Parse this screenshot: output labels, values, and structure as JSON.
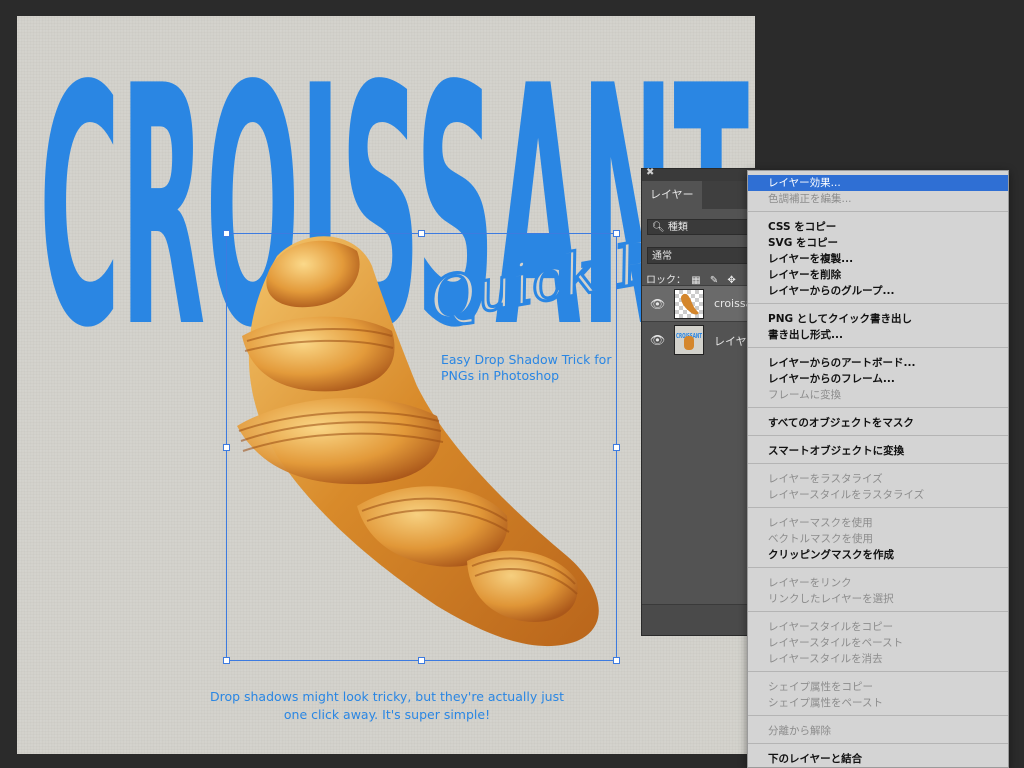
{
  "canvas": {
    "title_word": "CROISSANT",
    "script_subtitle": "Quick Pro Ti",
    "caption_top": "Easy Drop Shadow Trick for PNGs in Photoshop",
    "caption_bottom": "Drop shadows might look tricky, but they're actually just one click away. It's super simple!",
    "accent_color": "#2a86e3"
  },
  "layers_panel": {
    "tab_label": "レイヤー",
    "filter_label": "種類",
    "blend_mode": "通常",
    "lock_label": "ロック：",
    "layers": [
      {
        "name": "croissa",
        "icon": "croissant-thumbnail"
      },
      {
        "name": "レイヤー",
        "icon": "poster-thumbnail",
        "thumb_text": "CROISSANT"
      }
    ]
  },
  "context_menu": {
    "items": [
      {
        "label": "レイヤー効果...",
        "state": "highlight"
      },
      {
        "label": "色調補正を編集...",
        "state": "disabled"
      },
      {
        "label": "CSS をコピー",
        "state": "bold"
      },
      {
        "label": "SVG をコピー",
        "state": "bold"
      },
      {
        "label": "レイヤーを複製...",
        "state": "bold"
      },
      {
        "label": "レイヤーを削除",
        "state": "bold"
      },
      {
        "label": "レイヤーからのグループ...",
        "state": "bold"
      },
      {
        "label": "PNG としてクイック書き出し",
        "state": "bold"
      },
      {
        "label": "書き出し形式...",
        "state": "bold"
      },
      {
        "label": "レイヤーからのアートボード...",
        "state": "bold"
      },
      {
        "label": "レイヤーからのフレーム...",
        "state": "bold"
      },
      {
        "label": "フレームに変換",
        "state": "disabled"
      },
      {
        "label": "すべてのオブジェクトをマスク",
        "state": "bold"
      },
      {
        "label": "スマートオブジェクトに変換",
        "state": "bold"
      },
      {
        "label": "レイヤーをラスタライズ",
        "state": "disabled"
      },
      {
        "label": "レイヤースタイルをラスタライズ",
        "state": "disabled"
      },
      {
        "label": "レイヤーマスクを使用",
        "state": "disabled"
      },
      {
        "label": "ベクトルマスクを使用",
        "state": "disabled"
      },
      {
        "label": "クリッピングマスクを作成",
        "state": "bold"
      },
      {
        "label": "レイヤーをリンク",
        "state": "disabled"
      },
      {
        "label": "リンクしたレイヤーを選択",
        "state": "disabled"
      },
      {
        "label": "レイヤースタイルをコピー",
        "state": "disabled"
      },
      {
        "label": "レイヤースタイルをペースト",
        "state": "disabled"
      },
      {
        "label": "レイヤースタイルを消去",
        "state": "disabled"
      },
      {
        "label": "シェイプ属性をコピー",
        "state": "disabled"
      },
      {
        "label": "シェイプ属性をペースト",
        "state": "disabled"
      },
      {
        "label": "分離から解除",
        "state": "disabled"
      },
      {
        "label": "下のレイヤーと結合",
        "state": "bold"
      }
    ]
  }
}
